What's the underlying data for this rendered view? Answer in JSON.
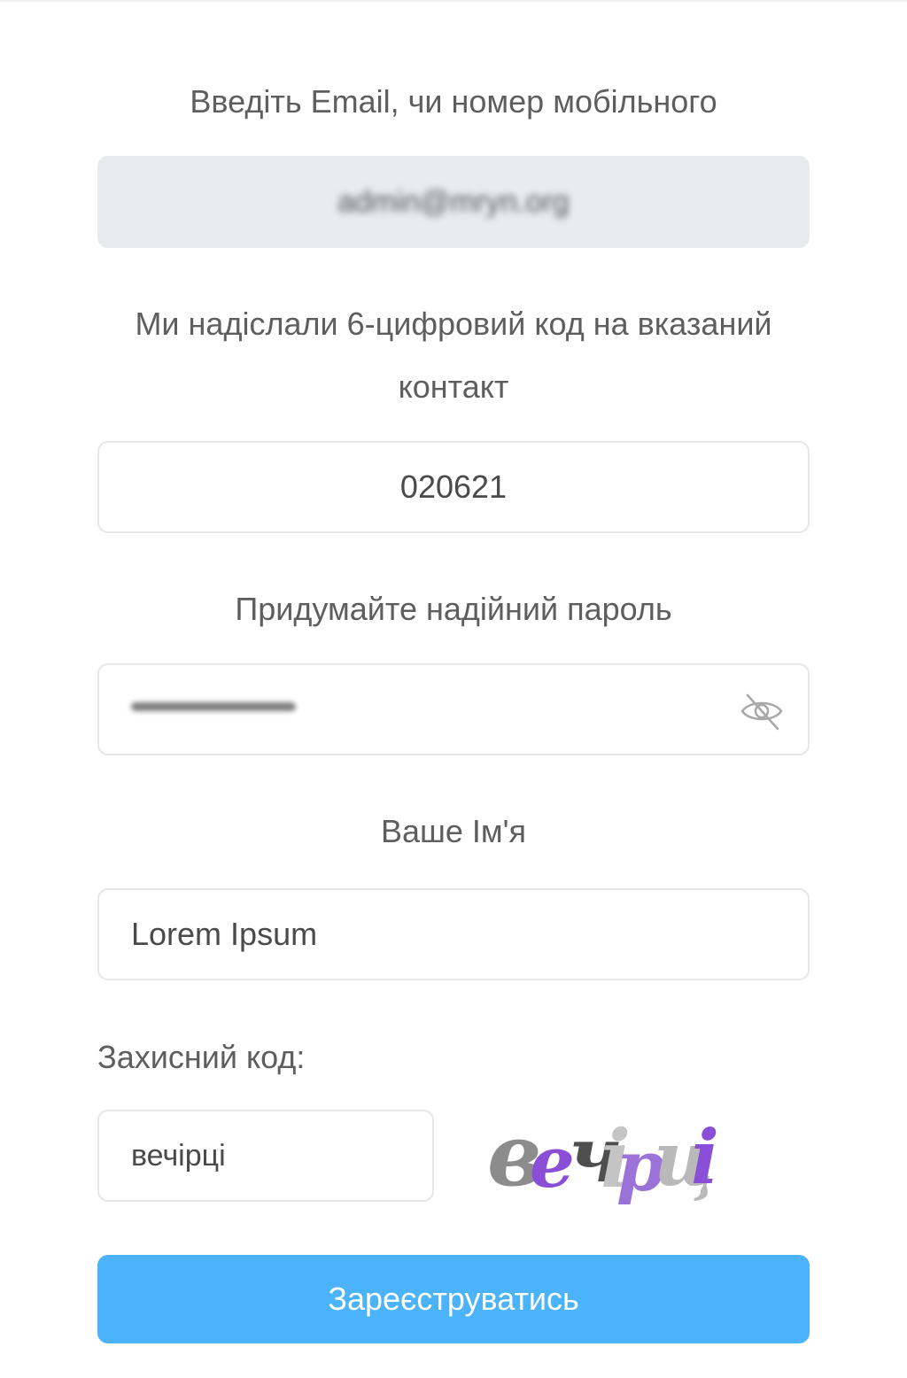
{
  "form": {
    "contact_label": "Введіть Email, чи номер мобільного",
    "contact_value": "admin@mryn.org",
    "code_label_line1": "Ми надіслали 6-цифровий код на вказаний",
    "code_label_line2": "контакт",
    "code_value": "020621",
    "password_label": "Придумайте надійний пароль",
    "name_label": "Ваше Ім'я",
    "name_value": "Lorem Ipsum",
    "captcha_label": "Захисний код:",
    "captcha_value": "вечірці",
    "captcha_image_text": "вечірці",
    "submit_label": "Зареєструватись"
  },
  "icons": {
    "password_toggle": "eye-off-icon"
  },
  "colors": {
    "accent": "#4ab3f9",
    "label": "#5e5e5e",
    "field_border": "#e6e7e9",
    "filled_field_bg": "#e9ebee"
  }
}
